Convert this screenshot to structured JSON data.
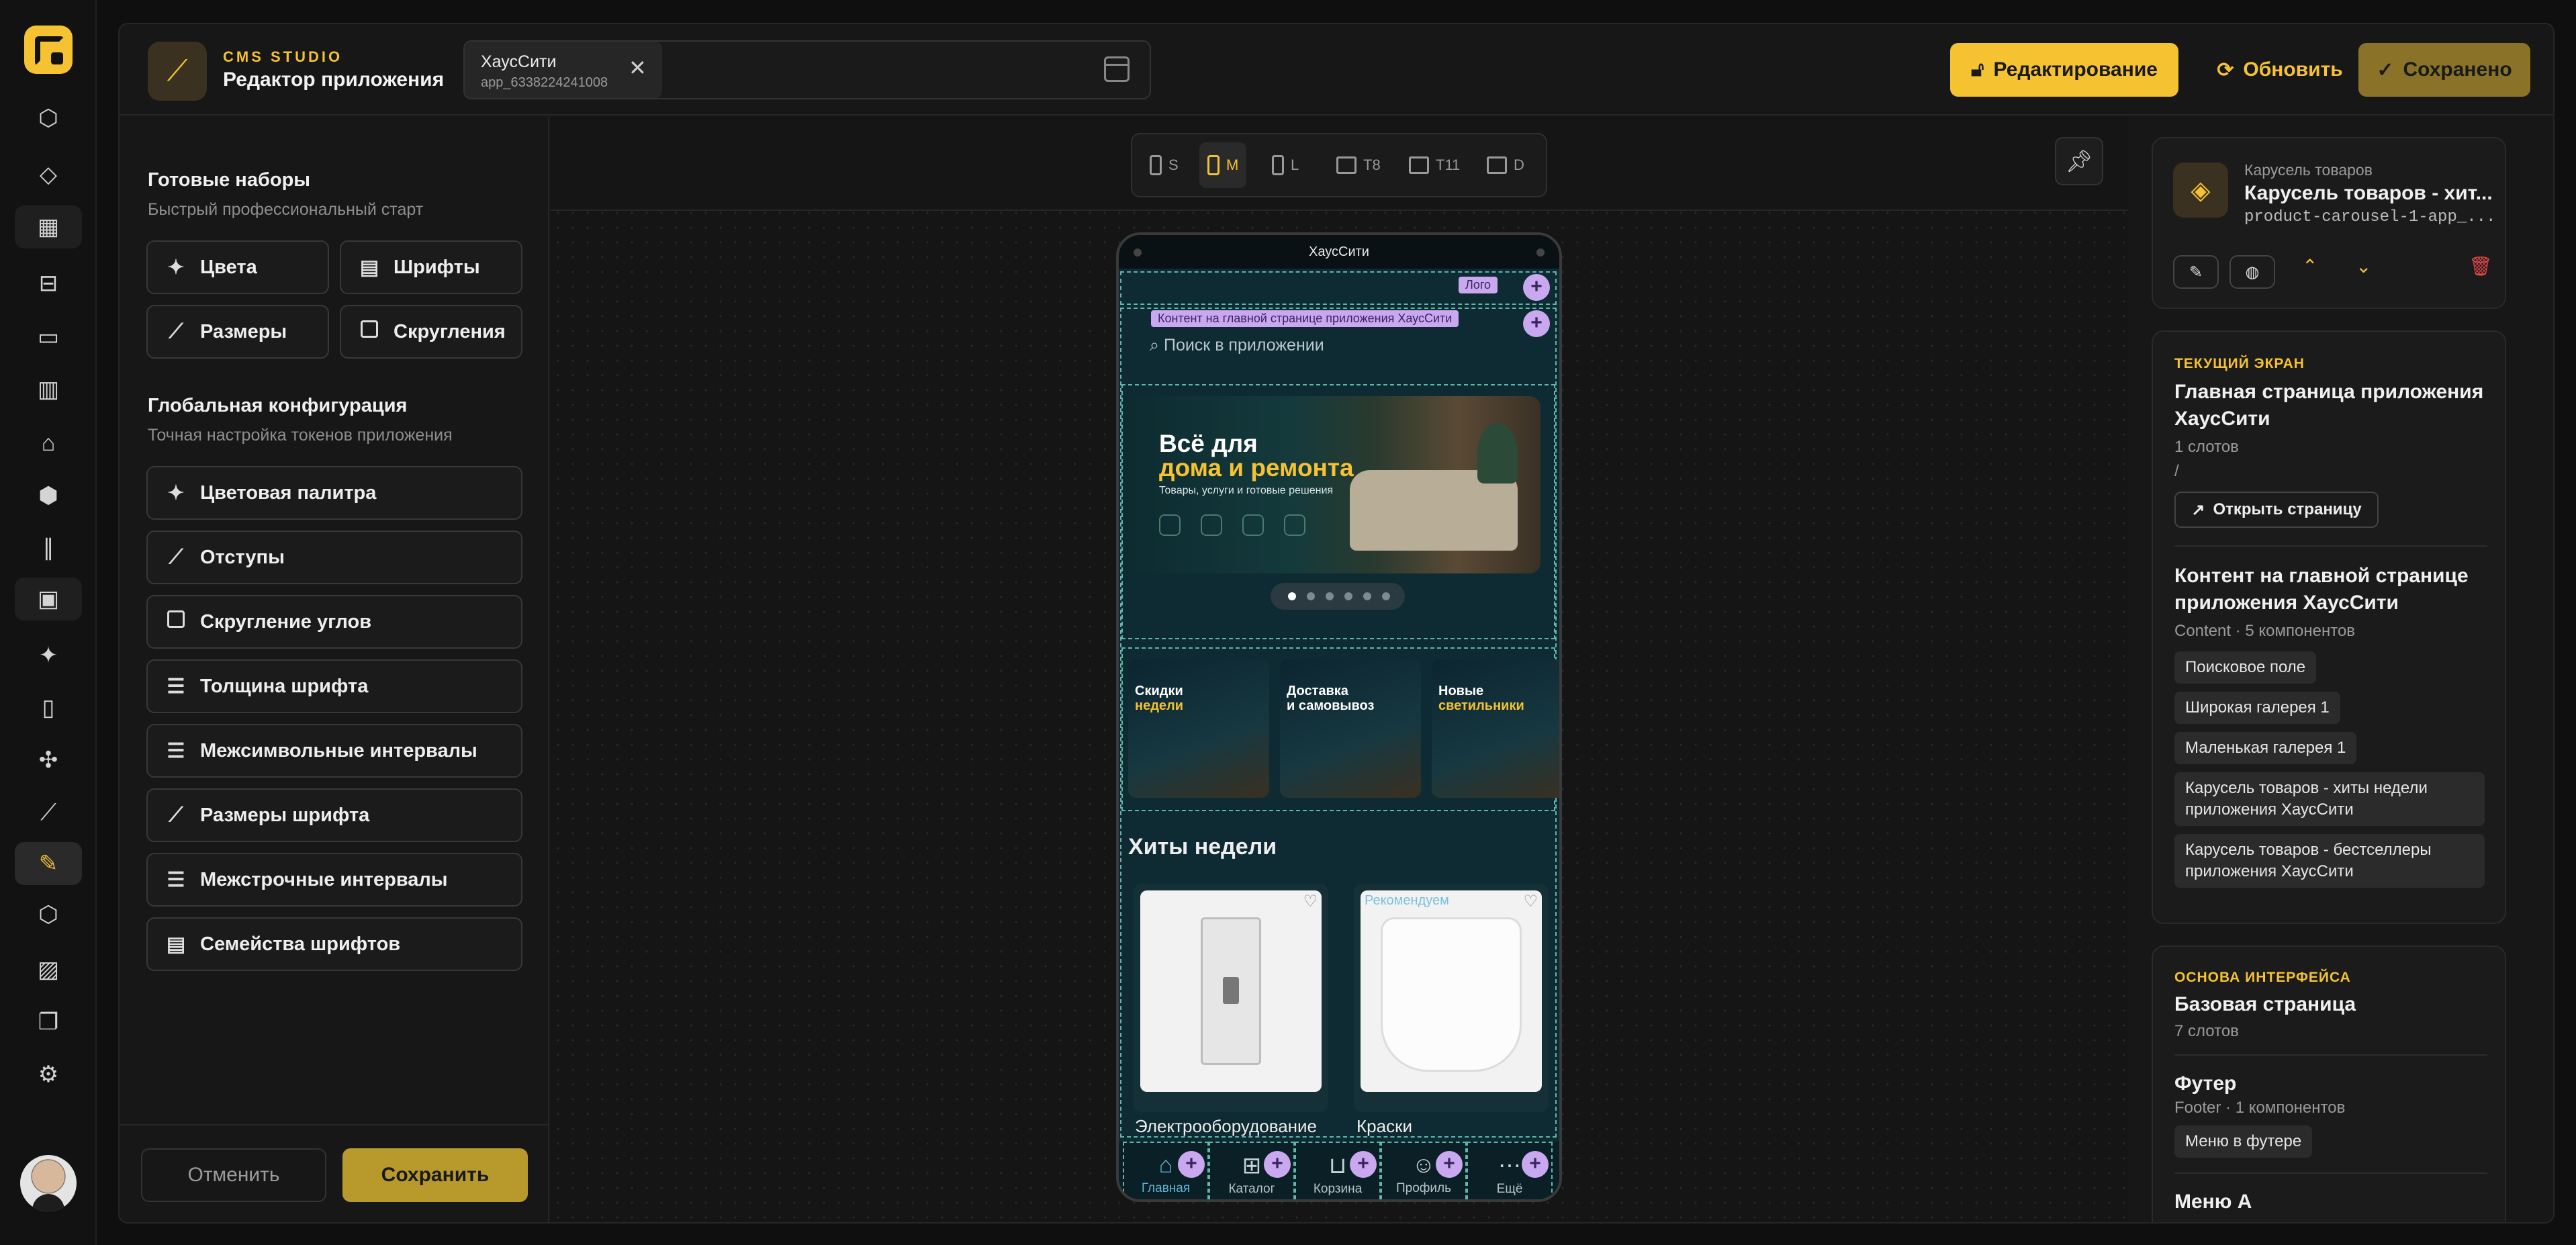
{
  "header": {
    "brand_caption": "CMS STUDIO",
    "brand_title": "Редактор приложения",
    "app_name": "ХаусСити",
    "app_id": "app_6338224241008",
    "btn_edit": "Редактирование",
    "btn_refresh": "Обновить",
    "btn_saved": "Сохранено"
  },
  "left_panel": {
    "presets_title": "Готовые наборы",
    "presets_sub": "Быстрый профессиональный старт",
    "presets": [
      "Цвета",
      "Шрифты",
      "Размеры",
      "Скругления"
    ],
    "global_title": "Глобальная конфигурация",
    "global_sub": "Точная настройка токенов приложения",
    "tokens": [
      "Цветовая палитра",
      "Отступы",
      "Скругление углов",
      "Толщина шрифта",
      "Межсимвольные интервалы",
      "Размеры шрифта",
      "Межстрочные интервалы",
      "Семейства шрифтов"
    ],
    "cancel": "Отменить",
    "save": "Сохранить"
  },
  "breakpoints": [
    {
      "key": "S",
      "active": false
    },
    {
      "key": "M",
      "active": true
    },
    {
      "key": "L",
      "active": false
    },
    {
      "key": "T8",
      "active": false
    },
    {
      "key": "T11",
      "active": false
    },
    {
      "key": "D",
      "active": false
    }
  ],
  "phone": {
    "status_title": "ХаусСити",
    "logo_tag": "Лого",
    "content_tag": "Контент на главной странице приложения ХаусСити",
    "search_placeholder": "Поиск в приложении",
    "banner": {
      "line1": "Всё для",
      "line2": "дома и ремонта",
      "line3": "Товары, услуги и готовые решения",
      "active_dot": 1,
      "dots": 6
    },
    "promo_cards": [
      {
        "l1": "Скидки",
        "l2": "недели"
      },
      {
        "l1": "Доставка",
        "l2": "и самовывоз"
      },
      {
        "l1": "Новые",
        "l2": "светильники"
      }
    ],
    "hits_title": "Хиты недели",
    "products": [
      {
        "name": "Электрооборудование",
        "tag": ""
      },
      {
        "name": "Краски",
        "tag": "Рекомендуем"
      }
    ],
    "nav": [
      {
        "label": "Главная",
        "icon": "home-icon",
        "active": true
      },
      {
        "label": "Каталог",
        "icon": "catalog-icon",
        "active": false
      },
      {
        "label": "Корзина",
        "icon": "cart-icon",
        "active": false
      },
      {
        "label": "Профиль",
        "icon": "profile-icon",
        "active": false
      },
      {
        "label": "Ещё",
        "icon": "more-icon",
        "active": false
      }
    ]
  },
  "right_panel": {
    "component_caption": "Карусель товаров",
    "component_title": "Карусель товаров - хит...",
    "component_id": "product-carousel-1-app_...",
    "current_caption": "ТЕКУЩИЙ ЭКРАН",
    "current_title_1": "Главная страница приложения",
    "current_title_2": "ХаусСити",
    "current_slots": "1 слотов",
    "current_path": "/",
    "open_page": "Открыть страницу",
    "content_title_1": "Контент на главной странице",
    "content_title_2": "приложения ХаусСити",
    "content_meta": "Content · 5 компонентов",
    "content_items": [
      "Поисковое поле",
      "Широкая галерея 1",
      "Маленькая галерея 1",
      "Карусель товаров - хиты недели приложения ХаусСити",
      "Карусель товаров - бестселлеры приложения ХаусСити"
    ],
    "base_caption": "ОСНОВА ИНТЕРФЕЙСА",
    "base_title": "Базовая страница",
    "base_slots": "7 слотов",
    "footer_title": "Футер",
    "footer_meta": "Footer · 1 компонентов",
    "footer_item": "Меню в футере",
    "menu_title": "Меню А"
  },
  "colors": {
    "accent": "#f5c232",
    "slot": "#5fb7a8",
    "tag": "#c9a8f0",
    "danger": "#e54848"
  }
}
